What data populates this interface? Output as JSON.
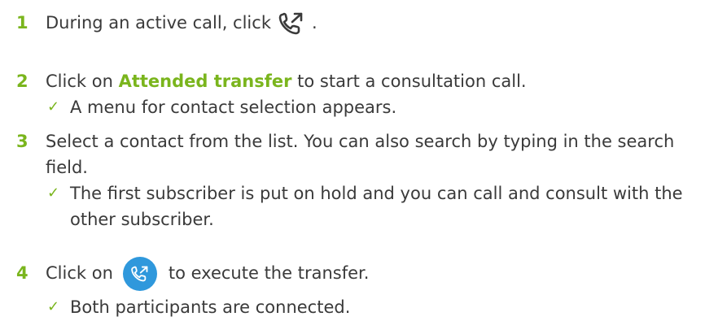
{
  "colors": {
    "accent_green": "#7ab51d",
    "text": "#3a3a3a",
    "icon_blue": "#2f98dc"
  },
  "steps": [
    {
      "number": "1",
      "text_before": "During an active call, click",
      "icon": "call-transfer-icon",
      "text_after": "."
    },
    {
      "number": "2",
      "text_before": "Click on",
      "link": "Attended transfer",
      "text_after": "to start a consultation call.",
      "result": "A menu for contact selection appears."
    },
    {
      "number": "3",
      "text": "Select a contact from the list. You can also search by typing in the search field.",
      "result": "The first subscriber is put on hold and you can call and consult with the other subscriber."
    },
    {
      "number": "4",
      "text_before": "Click on",
      "icon": "call-transfer-button-icon",
      "text_after": "to execute the transfer.",
      "result": "Both participants are connected."
    }
  ],
  "check_glyph": "✓"
}
